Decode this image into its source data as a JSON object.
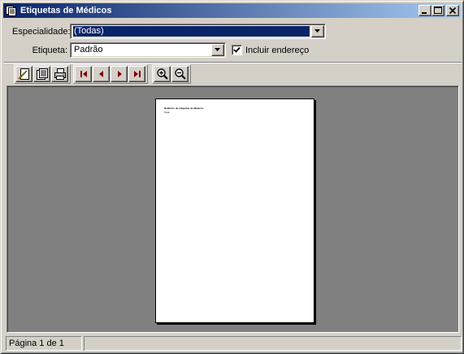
{
  "window": {
    "title": "Etiquetas de Médicos",
    "title_icon": "report-icon"
  },
  "form": {
    "especialidade_label": "Especialidade:",
    "especialidade_value": "(Todas)",
    "etiqueta_label": "Etiqueta:",
    "etiqueta_value": "Padrão",
    "incluir_endereco_label": "Incluir endereço",
    "incluir_endereco_checked": true
  },
  "toolbar": {
    "buttons": [
      {
        "name": "page-setup-icon"
      },
      {
        "name": "properties-icon"
      },
      {
        "name": "print-icon"
      },
      {
        "name": "first-page-icon"
      },
      {
        "name": "previous-page-icon"
      },
      {
        "name": "next-page-icon"
      },
      {
        "name": "last-page-icon"
      },
      {
        "name": "zoom-in-icon"
      },
      {
        "name": "zoom-out-icon"
      }
    ]
  },
  "preview": {
    "page_line1": "Relatório de etiquetas de Médicos",
    "page_line2": "Total"
  },
  "status": {
    "page_text": "Página 1 de 1"
  },
  "colors": {
    "titlebar_start": "#0a246a",
    "titlebar_end": "#a6caf0",
    "face": "#d4d0c8",
    "preview_bg": "#808080",
    "nav_red": "#800000"
  }
}
